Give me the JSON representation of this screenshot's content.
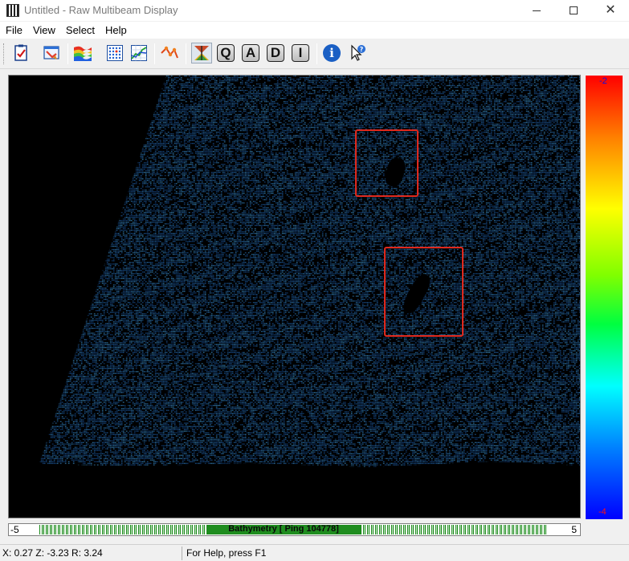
{
  "window": {
    "title": "Untitled - Raw Multibeam Display"
  },
  "menu": [
    "File",
    "View",
    "Select",
    "Help"
  ],
  "toolbar": {
    "buttons": [
      {
        "name": "checklist-icon"
      },
      {
        "name": "open-file-icon"
      },
      {
        "name": "colour-surface-icon"
      },
      {
        "name": "sounding-grid-icon"
      },
      {
        "name": "profile-chart-icon"
      },
      {
        "name": "track-edit-icon"
      },
      {
        "name": "bathymetry-view-icon"
      }
    ],
    "letters": [
      "Q",
      "A",
      "D",
      "I"
    ],
    "info_glyph": "i"
  },
  "colorscale": {
    "max_label": "-2",
    "min_label": "-4",
    "colors": [
      "#ff0000",
      "#ff8000",
      "#ffff00",
      "#80ff00",
      "#00ff40",
      "#00ffff",
      "#0080ff",
      "#0000ff"
    ]
  },
  "ruler": {
    "min": "-5",
    "max": "5",
    "label": "Bathymetry [ Ping 104778]"
  },
  "status": {
    "coords": "X: 0.27  Z: -3.23  R: 3.24",
    "help": "For Help, press F1"
  }
}
